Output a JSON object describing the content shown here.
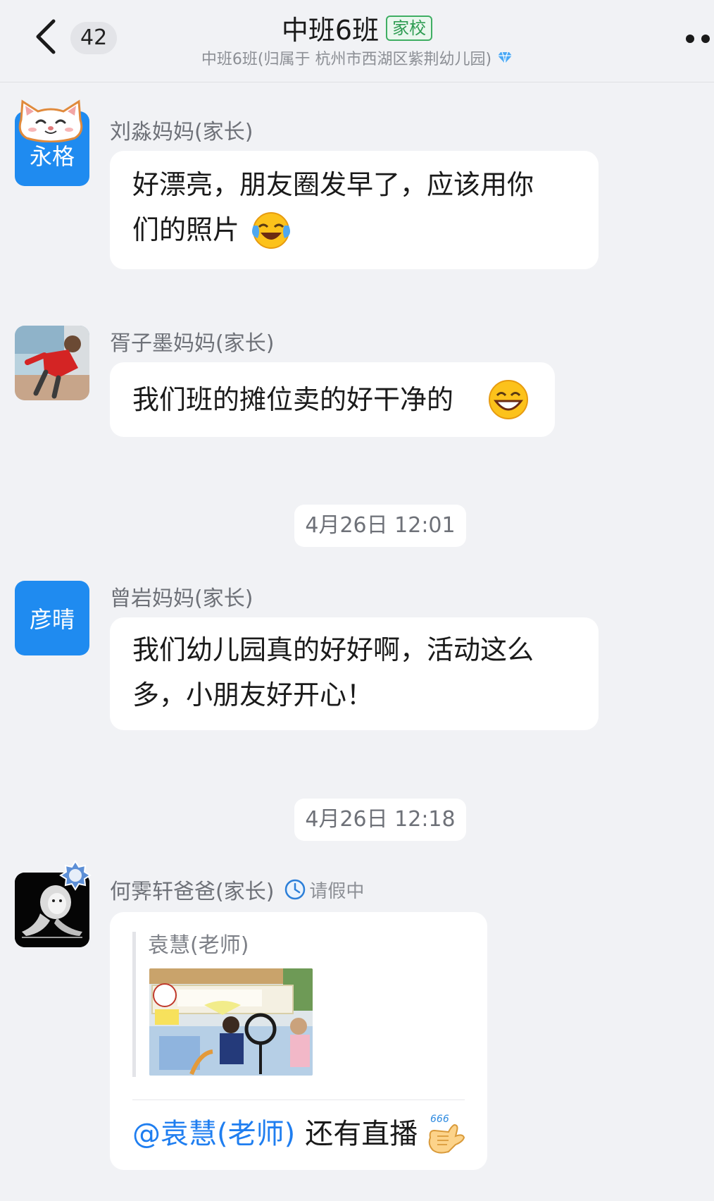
{
  "header": {
    "back_icon": "chevron-left-icon",
    "unread_count": "42",
    "title": "中班6班",
    "tag": "家校",
    "subtitle": "中班6班(归属于 杭州市西湖区紫荆幼儿园)",
    "verified_icon": "diamond-icon",
    "more_icon": "more-dots-icon"
  },
  "messages": [
    {
      "avatar_label": "永格",
      "avatar_decoration": "cat-face-icon",
      "sender": "刘淼妈妈(家长)",
      "lines": [
        "好漂亮，朋友圈发早了，应该用你",
        "们的照片"
      ],
      "emoji": "crying-laughing-emoji"
    },
    {
      "avatar": "child-photo",
      "sender": "胥子墨妈妈(家长)",
      "lines": [
        "我们班的摊位卖的好干净的"
      ],
      "emoji": "grinning-emoji"
    },
    {
      "time": "4月26日 12:01"
    },
    {
      "avatar_label": "彦晴",
      "sender": "曾岩妈妈(家长)",
      "lines": [
        "我们幼儿园真的好好啊，活动这么",
        "多，小朋友好开心！"
      ]
    },
    {
      "time": "4月26日 12:18"
    },
    {
      "avatar": "lion-photo",
      "sender": "何霁轩爸爸(家长)",
      "status_icon": "clock-icon",
      "status": "请假中",
      "quote": {
        "sender": "袁慧(老师)",
        "image": "kindergarten-stall-photo"
      },
      "mention": "@袁慧(老师)",
      "text": "还有直播",
      "emoji": "shaka-666-emoji"
    }
  ],
  "colors": {
    "background": "#f1f2f5",
    "bubble": "#ffffff",
    "avatar_blue": "#1f8bf0",
    "mention_blue": "#1f7ef0",
    "tag_green": "#2e9c52"
  }
}
